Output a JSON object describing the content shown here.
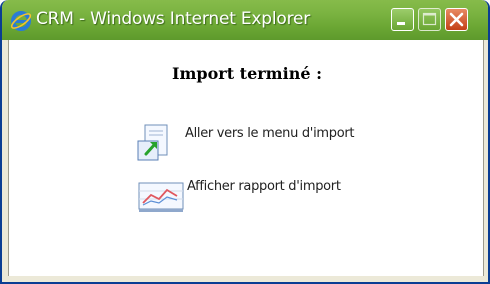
{
  "window": {
    "title": "CRM - Windows Internet Explorer",
    "buttons": {
      "minimize": "minimize-icon",
      "maximize": "maximize-icon",
      "close": "close-icon"
    }
  },
  "content": {
    "heading": "Import terminé :",
    "links": [
      {
        "label": "Aller vers le menu d'import",
        "icon": "import-menu-icon"
      },
      {
        "label": "Afficher rapport d'import",
        "icon": "report-chart-icon"
      }
    ]
  },
  "colors": {
    "titlebar": "#6aa633",
    "close_button": "#c44117",
    "content_bg": "#ffffff"
  }
}
